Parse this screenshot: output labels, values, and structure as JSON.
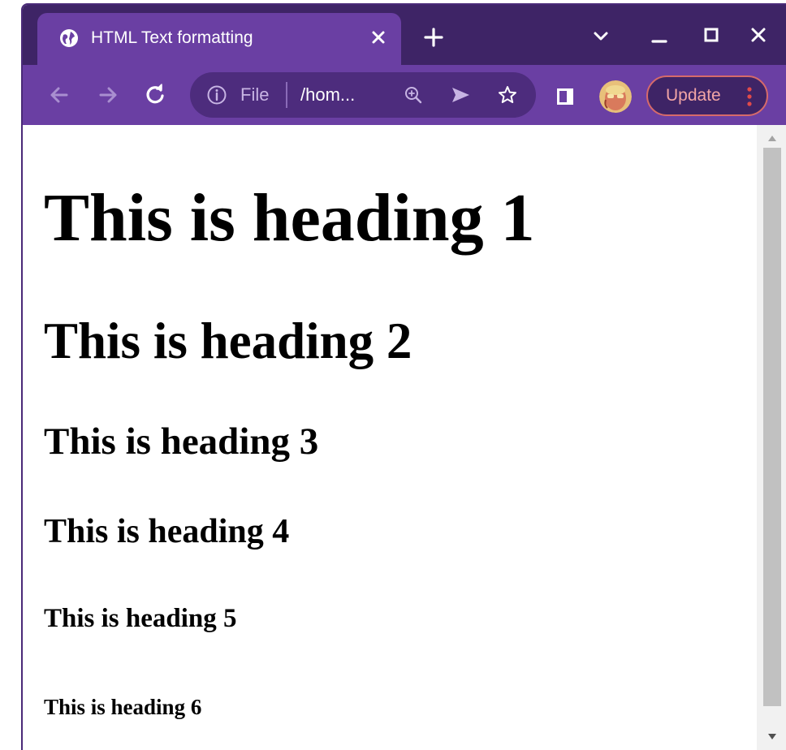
{
  "tab": {
    "title": "HTML Text formatting",
    "favicon": "globe-icon",
    "close_icon": "close-icon"
  },
  "new_tab_icon": "plus-icon",
  "window_controls": [
    "chevron-down-icon",
    "minimize-icon",
    "maximize-icon",
    "close-icon"
  ],
  "toolbar": {
    "back_icon": "back-arrow-icon",
    "forward_icon": "forward-arrow-icon",
    "reload_icon": "reload-icon",
    "omnibox": {
      "info_icon": "info-icon",
      "scheme": "File",
      "url": "/hom...",
      "zoom_icon": "zoom-icon",
      "send_icon": "send-icon",
      "bookmark_icon": "star-icon"
    },
    "side_panel_icon": "side-panel-icon",
    "avatar": "avatar",
    "update_label": "Update",
    "menu_icon": "kebab-menu-icon"
  },
  "page": {
    "h1": "This is heading 1",
    "h2": "This is heading 2",
    "h3": "This is heading 3",
    "h4": "This is heading 4",
    "h5": "This is heading 5",
    "h6": "This is heading 6"
  },
  "colors": {
    "titlebar": "#3e2466",
    "toolbar": "#6a3fa3",
    "omnibox": "#4d2c7d",
    "update_border": "#d66a6a",
    "update_text": "#f2a5a5"
  }
}
